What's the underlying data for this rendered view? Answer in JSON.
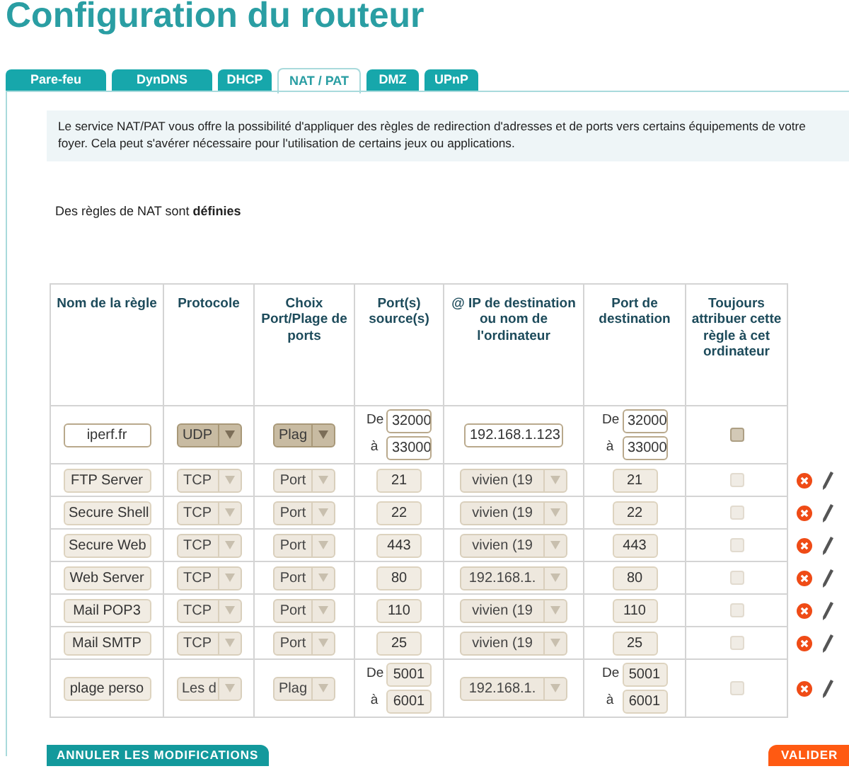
{
  "title": "Configuration du routeur",
  "tabs": [
    {
      "label": "Pare-feu",
      "selected": false
    },
    {
      "label": "DynDNS",
      "selected": false
    },
    {
      "label": "DHCP",
      "selected": false
    },
    {
      "label": "NAT / PAT",
      "selected": true
    },
    {
      "label": "DMZ",
      "selected": false
    },
    {
      "label": "UPnP",
      "selected": false
    }
  ],
  "info": "Le service NAT/PAT vous offre la possibilité d'appliquer des règles de redirection d'adresses et de ports vers certains équipements de votre foyer. Cela peut s'avérer nécessaire pour l'utilisation de certains jeux ou applications.",
  "status": "Des règles de NAT sont **définies**",
  "table": {
    "columns": [
      "Nom de la règle",
      "Protocole",
      "Choix Port/Plage de ports",
      "Port(s) source(s)",
      "@ IP de destination ou nom de l'ordinateur",
      "Port de destination",
      "Toujours attribuer cette règle à cet ordinateur"
    ],
    "rows": [
      {
        "name": "iperf.fr",
        "protocol": "UDP",
        "choice": "Plag",
        "source": {
          "kind": "range",
          "from_label": "De",
          "from": "32000",
          "to_label": "à",
          "to": "33000"
        },
        "destination": {
          "kind": "input",
          "value": "192.168.1.123"
        },
        "dest_port": {
          "kind": "range",
          "from_label": "De",
          "from": "32000",
          "to_label": "à",
          "to": "33000"
        },
        "checked": false,
        "disabled": false
      },
      {
        "name": "FTP Server",
        "protocol": "TCP",
        "choice": "Port",
        "source": {
          "kind": "single",
          "value": "21"
        },
        "destination": {
          "kind": "select",
          "value": "vivien (19"
        },
        "dest_port": {
          "kind": "single",
          "value": "21"
        },
        "checked": false,
        "disabled": true
      },
      {
        "name": "Secure Shell",
        "protocol": "TCP",
        "choice": "Port",
        "source": {
          "kind": "single",
          "value": "22"
        },
        "destination": {
          "kind": "select",
          "value": "vivien (19"
        },
        "dest_port": {
          "kind": "single",
          "value": "22"
        },
        "checked": false,
        "disabled": true
      },
      {
        "name": "Secure Web",
        "protocol": "TCP",
        "choice": "Port",
        "source": {
          "kind": "single",
          "value": "443"
        },
        "destination": {
          "kind": "select",
          "value": "vivien (19"
        },
        "dest_port": {
          "kind": "single",
          "value": "443"
        },
        "checked": false,
        "disabled": true
      },
      {
        "name": "Web Server",
        "protocol": "TCP",
        "choice": "Port",
        "source": {
          "kind": "single",
          "value": "80"
        },
        "destination": {
          "kind": "select",
          "value": "192.168.1."
        },
        "dest_port": {
          "kind": "single",
          "value": "80"
        },
        "checked": false,
        "disabled": true
      },
      {
        "name": "Mail POP3",
        "protocol": "TCP",
        "choice": "Port",
        "source": {
          "kind": "single",
          "value": "110"
        },
        "destination": {
          "kind": "select",
          "value": "vivien (19"
        },
        "dest_port": {
          "kind": "single",
          "value": "110"
        },
        "checked": false,
        "disabled": true
      },
      {
        "name": "Mail SMTP",
        "protocol": "TCP",
        "choice": "Port",
        "source": {
          "kind": "single",
          "value": "25"
        },
        "destination": {
          "kind": "select",
          "value": "vivien (19"
        },
        "dest_port": {
          "kind": "single",
          "value": "25"
        },
        "checked": false,
        "disabled": true
      },
      {
        "name": "plage perso",
        "protocol": "Les d",
        "choice": "Plag",
        "source": {
          "kind": "range",
          "from_label": "De",
          "from": "5001",
          "to_label": "à",
          "to": "6001"
        },
        "destination": {
          "kind": "select",
          "value": "192.168.1."
        },
        "dest_port": {
          "kind": "range",
          "from_label": "De",
          "from": "5001",
          "to_label": "à",
          "to": "6001"
        },
        "checked": false,
        "disabled": true
      }
    ]
  },
  "buttons": {
    "cancel": "ANNULER LES MODIFICATIONS",
    "submit": "VALIDER"
  }
}
